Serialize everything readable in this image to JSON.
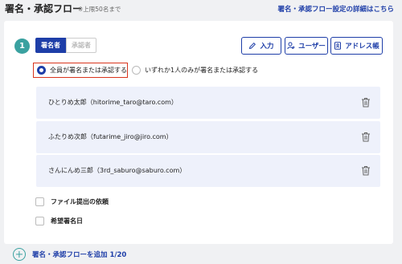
{
  "header": {
    "title": "署名・承認フロー",
    "limit_note": "※上限50名まで",
    "details_link": "署名・承認フロー設定の詳細はこちら"
  },
  "step": {
    "number": "1",
    "toggle": {
      "sign_label": "署名者",
      "approve_label": "承認者"
    },
    "buttons": {
      "input": "入力",
      "user": "ユーザー",
      "address_book": "アドレス帳"
    },
    "radio": {
      "all_label": "全員が署名または承認する",
      "any_label": "いずれか1人のみが署名または承認する",
      "selected": "all"
    },
    "signers": [
      {
        "label": "ひとりめ太郎（hitorime_taro@taro.com）"
      },
      {
        "label": "ふたりめ次郎（futarime_jiro@jiro.com）"
      },
      {
        "label": "さんにんめ三郎（3rd_saburo@saburo.com）"
      }
    ],
    "options": {
      "file_request": "ファイル提出の依頼",
      "desired_date": "希望署名日"
    }
  },
  "footer": {
    "add_flow_label": "署名・承認フローを追加 1/20"
  },
  "colors": {
    "primary": "#1e3ea8",
    "accent_teal": "#3aa1a0",
    "highlight_red": "#d9341c",
    "signer_bg": "#eef1fb"
  }
}
